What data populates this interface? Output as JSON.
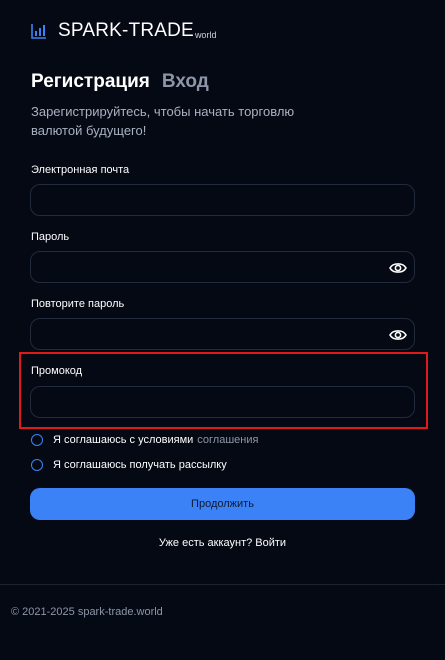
{
  "brand": {
    "name": "SPARK-TRADE",
    "suffix": "world",
    "icon": "bar-chart-icon",
    "color": "#3b82f6"
  },
  "tabs": {
    "register": "Регистрация",
    "login": "Вход"
  },
  "subtitle": "Зарегистрируйтесь, чтобы начать торговлю валютой будущего!",
  "form": {
    "email_label": "Электронная почта",
    "email_value": "",
    "password_label": "Пароль",
    "password_value": "",
    "repeat_password_label": "Повторите пароль",
    "repeat_password_value": "",
    "promo_label": "Промокод",
    "promo_value": ""
  },
  "agreements": {
    "terms_text": "Я соглашаюсь с условиями",
    "terms_link": "соглашения",
    "newsletter_text": "Я соглашаюсь получать рассылку"
  },
  "continue_label": "Продолжить",
  "login_prompt": "Уже есть аккаунт? Войти",
  "footer": "© 2021-2025 spark-trade.world",
  "colors": {
    "background": "#050914",
    "accent": "#3b82f6",
    "highlight": "#e0191b"
  }
}
